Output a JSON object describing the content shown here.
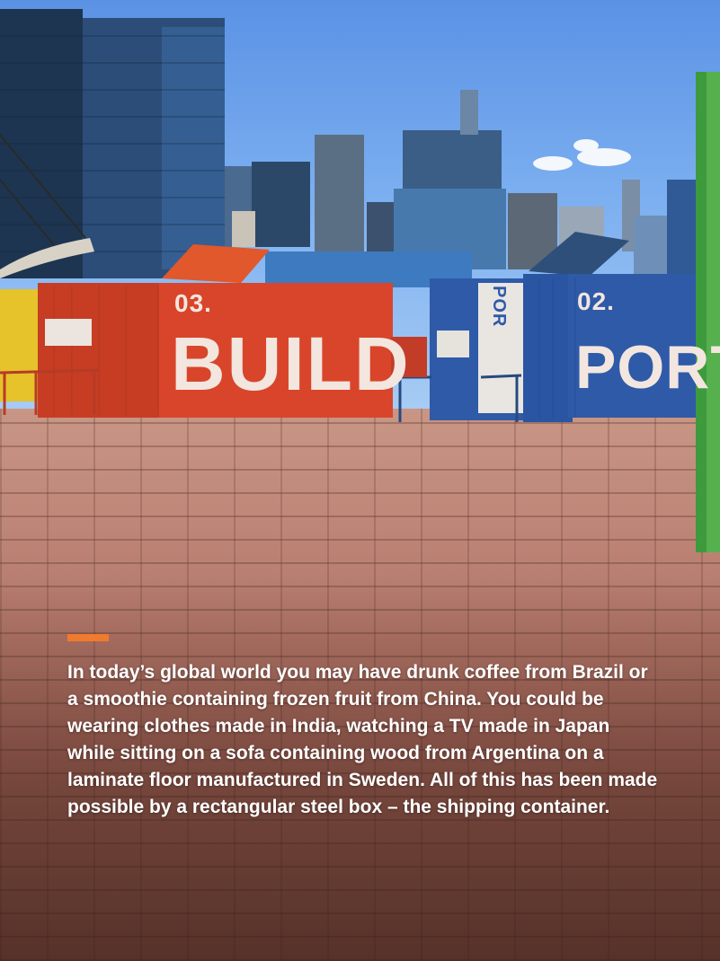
{
  "photo": {
    "container_build": {
      "number": "03.",
      "word": "BUILD",
      "color": "#d9452a"
    },
    "container_port": {
      "number": "02.",
      "word": "PORT",
      "color": "#2f5aa8"
    },
    "container_side_word": "POR"
  },
  "caption": {
    "text": "In today’s global world you may have drunk coffee from Brazil or a smoothie containing frozen fruit from China. You could be wearing clothes made in India, watching a TV made in Japan while sitting on a sofa containing wood from Argentina on a laminate floor manufactured in Sweden. All of this has been made possible by a rectangular steel box – the shipping container."
  },
  "colors": {
    "accent": "#f07a2d",
    "text": "#ffffff"
  }
}
